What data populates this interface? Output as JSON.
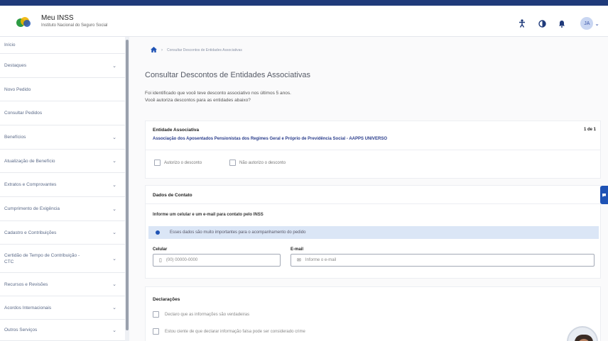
{
  "header": {
    "brand_title": "Meu INSS",
    "brand_subtitle": "Instituto Nacional do Seguro Social",
    "avatar_initials": "JA",
    "colors": {
      "topline": "#1f3a7a",
      "accent": "#1f53b5"
    }
  },
  "sidebar": {
    "items": [
      {
        "label": "Início",
        "chevron": false
      },
      {
        "label": "Destaques",
        "chevron": true
      },
      {
        "label": "Novo Pedido",
        "chevron": false
      },
      {
        "label": "Consultar Pedidos",
        "chevron": false
      },
      {
        "label": "Benefícios",
        "chevron": true
      },
      {
        "label": "Atualização de Benefício",
        "chevron": true
      },
      {
        "label": "Extratos e Comprovantes",
        "chevron": true
      },
      {
        "label": "Cumprimento de Exigência",
        "chevron": true
      },
      {
        "label": "Cadastro e Contribuições",
        "chevron": true
      },
      {
        "label": "Certidão de Tempo de Contribuição - CTC",
        "chevron": true
      },
      {
        "label": "Recursos e Revisões",
        "chevron": true
      },
      {
        "label": "Acordos Internacionais",
        "chevron": true
      },
      {
        "label": "Outros Serviços",
        "chevron": true
      }
    ]
  },
  "main": {
    "breadcrumb": "Consultar Descontos de Entidades Associativas",
    "title": "Consultar Descontos de Entidades Associativas",
    "intro_line1": "Foi identificado que você teve desconto associativo nos últimos 5 anos.",
    "intro_line2": "Você autoriza descontos para as entidades abaixo?",
    "entity_card": {
      "title": "Entidade Associativa",
      "count": "1 de 1",
      "name": "Associação dos Aposentados Pensionistas dos Regimes Geral e Próprio de Previdência Social - AAPPS UNIVERSO",
      "options": [
        "Autorizo o desconto",
        "Não autorizo o desconto"
      ]
    },
    "contact_card": {
      "title": "Dados de Contato",
      "subtitle": "Informe um celular e um e-mail para contato pelo INSS",
      "info": "Esses dados são muito importantes para o acompanhamento do pedido",
      "phone_label": "Celular",
      "phone_placeholder": "(00) 00000-0000",
      "email_label": "E-mail",
      "email_placeholder": "Informe o e-mail"
    },
    "declarations": {
      "title": "Declarações",
      "items": [
        "Declaro que as informações são verdadeiras",
        "Estou ciente de que declarar informação falsa pode ser considerado crime"
      ]
    }
  }
}
